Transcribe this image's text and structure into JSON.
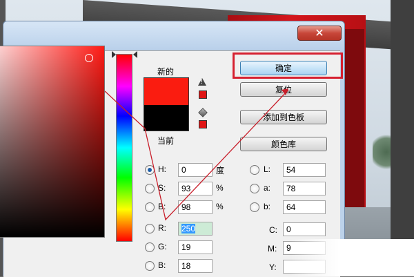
{
  "dialog": {
    "close_glyph": "✕",
    "preview": {
      "new_label": "新的",
      "current_label": "当前",
      "new_color": "#fa1c10",
      "current_color": "#000000"
    },
    "buttons": {
      "ok": "确定",
      "reset": "复位",
      "add_swatch": "添加到色板",
      "libraries": "颜色库"
    },
    "hsb": {
      "h": {
        "label": "H:",
        "value": "0",
        "unit": "度"
      },
      "s": {
        "label": "S:",
        "value": "93",
        "unit": "%"
      },
      "b": {
        "label": "B:",
        "value": "98",
        "unit": "%"
      },
      "selected": "H"
    },
    "lab": {
      "l": {
        "label": "L:",
        "value": "54"
      },
      "a": {
        "label": "a:",
        "value": "78"
      },
      "b": {
        "label": "b:",
        "value": "64"
      }
    },
    "rgb": {
      "r": {
        "label": "R:",
        "value": "250"
      },
      "g": {
        "label": "G:",
        "value": "19"
      },
      "b": {
        "label": "B:",
        "value": "18"
      }
    },
    "cmyk": {
      "c": {
        "label": "C:",
        "value": "0"
      },
      "m": {
        "label": "M:",
        "value": "9"
      },
      "y": {
        "label": "Y:",
        "value": ""
      }
    },
    "icons": {
      "gamut_warning": "warning-triangle-icon",
      "websafe": "cube-icon"
    }
  },
  "colors": {
    "accent_red": "#d62030",
    "picked": "#fa1c10"
  }
}
